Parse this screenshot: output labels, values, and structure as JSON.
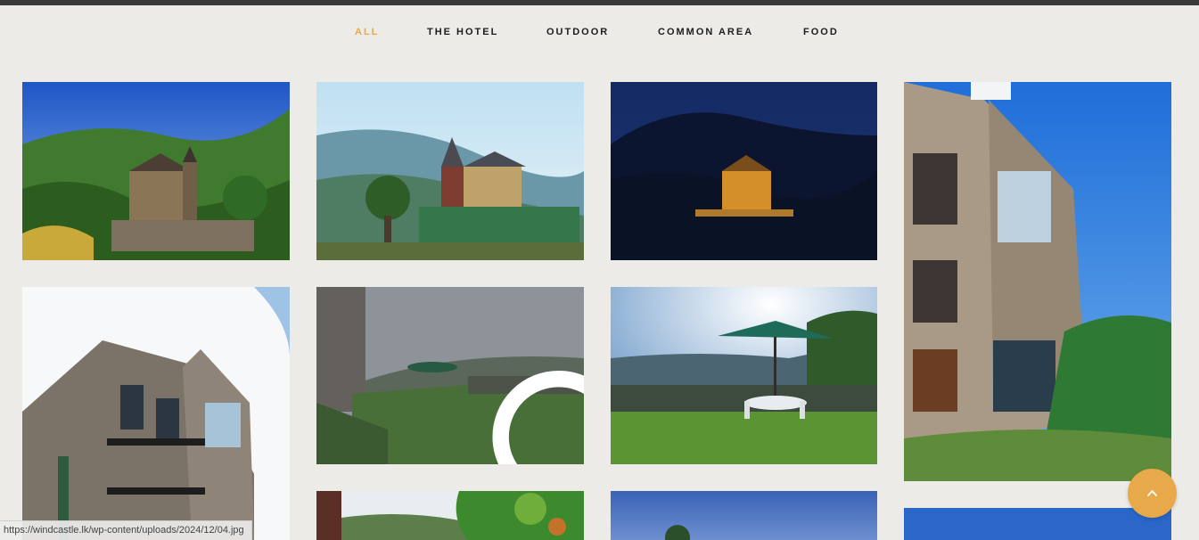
{
  "filters": [
    {
      "label": "ALL",
      "active": true
    },
    {
      "label": "THE HOTEL"
    },
    {
      "label": "OUTDOOR"
    },
    {
      "label": "COMMON AREA"
    },
    {
      "label": "FOOD"
    }
  ],
  "gallery": {
    "items": [
      {
        "subject": "castle hotel daytime view"
      },
      {
        "subject": "castle hotel with mountain valley"
      },
      {
        "subject": "castle hotel at night"
      },
      {
        "subject": "stone tower with flag"
      },
      {
        "subject": "stone building low angle"
      },
      {
        "subject": "garden lawn with umbrella",
        "hovered": true
      },
      {
        "subject": "terrace with umbrella and chairs"
      },
      {
        "subject": "garden foliage"
      },
      {
        "subject": "sky view"
      },
      {
        "subject": "blue sky"
      }
    ]
  },
  "status_bar": {
    "url": "https://windcastle.lk/wp-content/uploads/2024/12/04.jpg"
  },
  "accent_color": "#e8a94b",
  "icons": {
    "zoom": "magnifier-icon",
    "to_top": "chevron-up-icon"
  }
}
